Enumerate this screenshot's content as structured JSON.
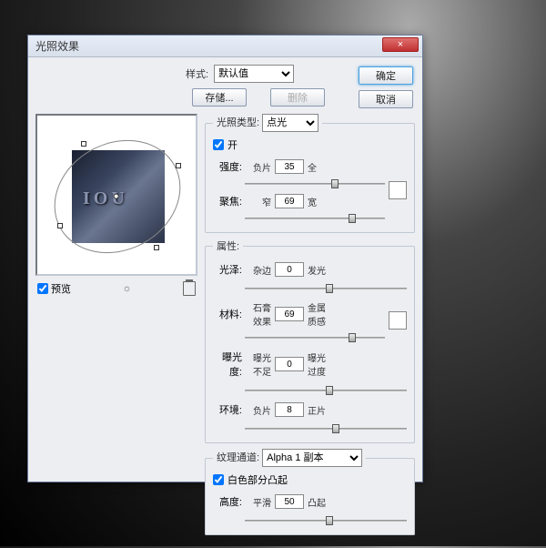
{
  "window": {
    "title": "光照效果",
    "close": "×"
  },
  "buttons": {
    "ok": "确定",
    "cancel": "取消",
    "save": "存储...",
    "delete": "删除"
  },
  "style": {
    "label": "样式:",
    "value": "默认值"
  },
  "preview": {
    "checkbox": "预览",
    "text": "IOU"
  },
  "light": {
    "legend": "光照类型:",
    "type": "点光",
    "on": "开",
    "intensity": {
      "label": "强度:",
      "min": "负片",
      "max": "全",
      "value": "35",
      "pct": 62
    },
    "focus": {
      "label": "聚焦:",
      "min": "窄",
      "max": "宽",
      "value": "69",
      "pct": 74
    }
  },
  "props": {
    "legend": "属性:",
    "gloss": {
      "label": "光泽:",
      "min": "杂边",
      "max": "发光",
      "value": "0",
      "pct": 50
    },
    "material": {
      "label": "材料:",
      "min": "石膏效果",
      "max": "金属质感",
      "value": "69",
      "pct": 74
    },
    "exposure": {
      "label": "曝光度:",
      "min": "曝光不足",
      "max": "曝光过度",
      "value": "0",
      "pct": 50
    },
    "ambience": {
      "label": "环境:",
      "min": "负片",
      "max": "正片",
      "value": "8",
      "pct": 54
    }
  },
  "texture": {
    "legend": "纹理通道:",
    "channel": "Alpha 1 副本",
    "white": "白色部分凸起",
    "height": {
      "label": "高度:",
      "min": "平滑",
      "max": "凸起",
      "value": "50",
      "pct": 50
    }
  }
}
